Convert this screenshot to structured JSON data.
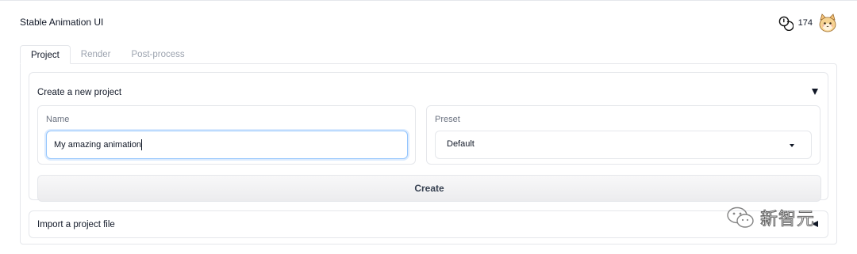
{
  "app": {
    "title": "Stable Animation UI"
  },
  "header": {
    "credits": "174",
    "credits_icon": "coin-icon",
    "avatar_icon": "cat-avatar-icon"
  },
  "tabs": [
    {
      "label": "Project",
      "active": true
    },
    {
      "label": "Render",
      "active": false
    },
    {
      "label": "Post-process",
      "active": false
    }
  ],
  "create_project": {
    "header": "Create a new project",
    "name_label": "Name",
    "name_value": "My amazing animation",
    "preset_label": "Preset",
    "preset_value": "Default",
    "create_label": "Create"
  },
  "import_project": {
    "header": "Import a project file"
  },
  "watermark": {
    "text": "新智元",
    "icon": "wechat-icon"
  },
  "colors": {
    "border": "#e5e7eb",
    "focus": "#93c5fd",
    "text": "#111827",
    "muted": "#9ca3af"
  }
}
